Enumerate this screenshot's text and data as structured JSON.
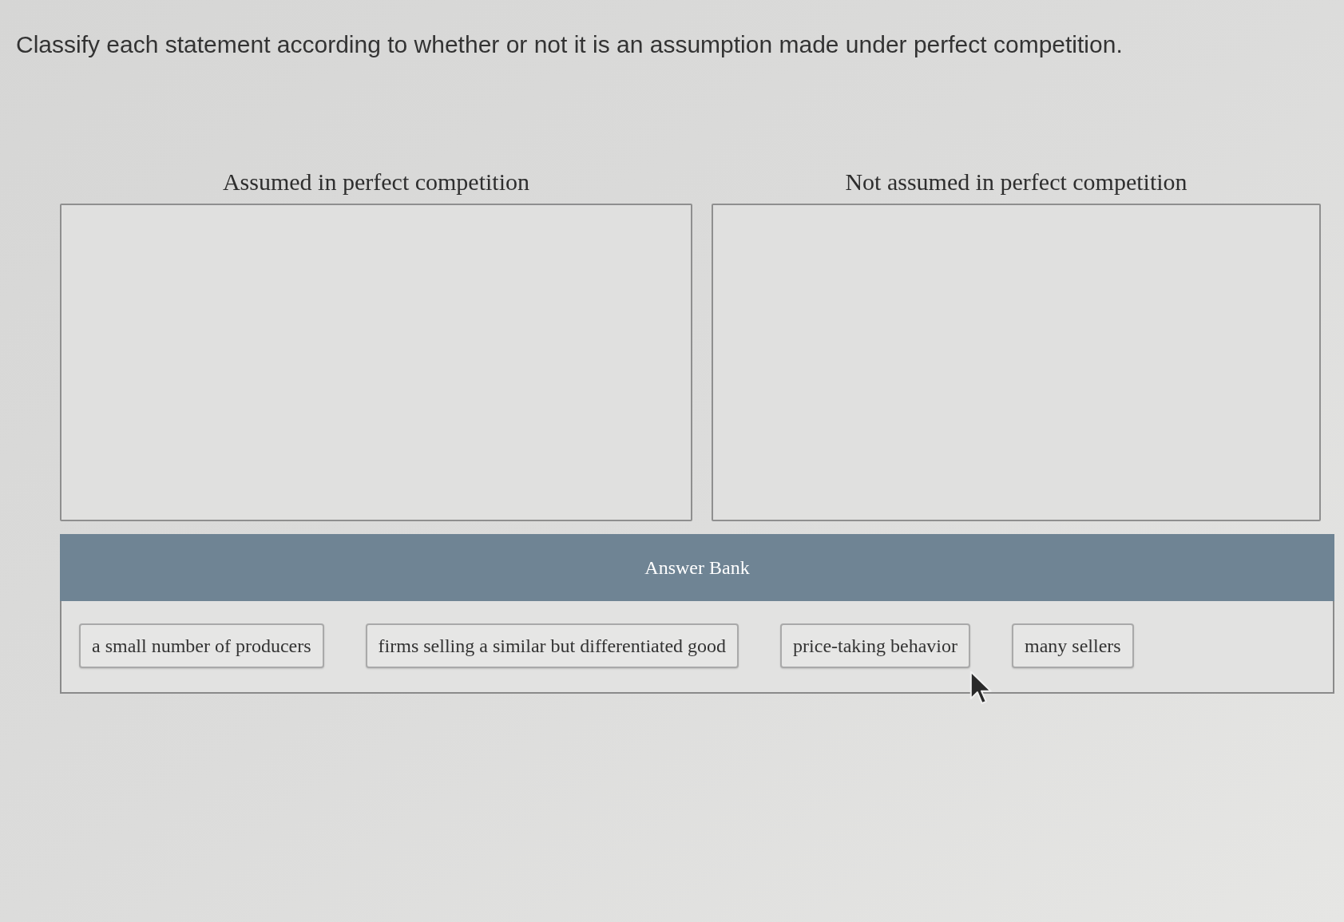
{
  "question": {
    "text": "Classify each statement according to whether or not it is an assumption made under perfect competition."
  },
  "categories": [
    {
      "heading": "Assumed in perfect competition"
    },
    {
      "heading": "Not assumed in perfect competition"
    }
  ],
  "answer_bank": {
    "title": "Answer Bank",
    "items": [
      "a small number of producers",
      "firms selling a similar but differentiated good",
      "price-taking behavior",
      "many sellers"
    ]
  }
}
